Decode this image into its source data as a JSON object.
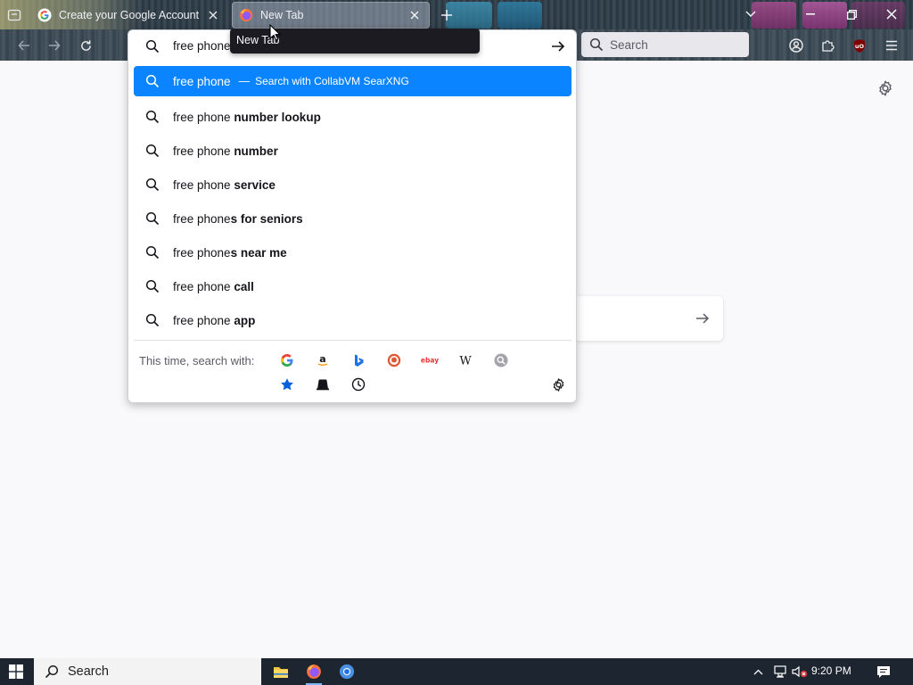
{
  "browser": {
    "tabs": [
      {
        "title": "Create your Google Account",
        "favicon": "google-g-icon",
        "active": false
      },
      {
        "title": "New Tab",
        "favicon": "firefox-icon",
        "active": true
      }
    ],
    "tooltip": "New Tab"
  },
  "urlbar": {
    "value": "free phone"
  },
  "suggestions": {
    "selected": {
      "query": "free phone",
      "separator": "—",
      "action": "Search with CollabVM SearXNG"
    },
    "items": [
      {
        "typed": "free phone ",
        "completion": "number lookup"
      },
      {
        "typed": "free phone ",
        "completion": "number"
      },
      {
        "typed": "free phone ",
        "completion": "service"
      },
      {
        "typed": "free phone",
        "completion": "s for seniors"
      },
      {
        "typed": "free phone",
        "completion": "s near me"
      },
      {
        "typed": "free phone ",
        "completion": "call"
      },
      {
        "typed": "free phone ",
        "completion": "app"
      }
    ]
  },
  "oneoffs": {
    "label": "This time, search with:",
    "engines": [
      "google-icon",
      "amazon-icon",
      "bing-icon",
      "duckduckgo-icon",
      "ebay-icon",
      "wikipedia-icon",
      "searxng-icon"
    ],
    "modes": [
      "bookmarks-star-icon",
      "tabs-icon",
      "history-clock-icon"
    ],
    "ebay_text": "ebay",
    "wiki_text": "W",
    "amazon_text": "a"
  },
  "search_box": {
    "placeholder": "Search"
  },
  "taskbar": {
    "search_placeholder": "Search",
    "clock": "9:20 PM",
    "apps": [
      "file-explorer-icon",
      "firefox-icon",
      "chrome-icon"
    ]
  },
  "colors": {
    "accent": "#0a84ff",
    "taskbar": "#1c2530"
  }
}
